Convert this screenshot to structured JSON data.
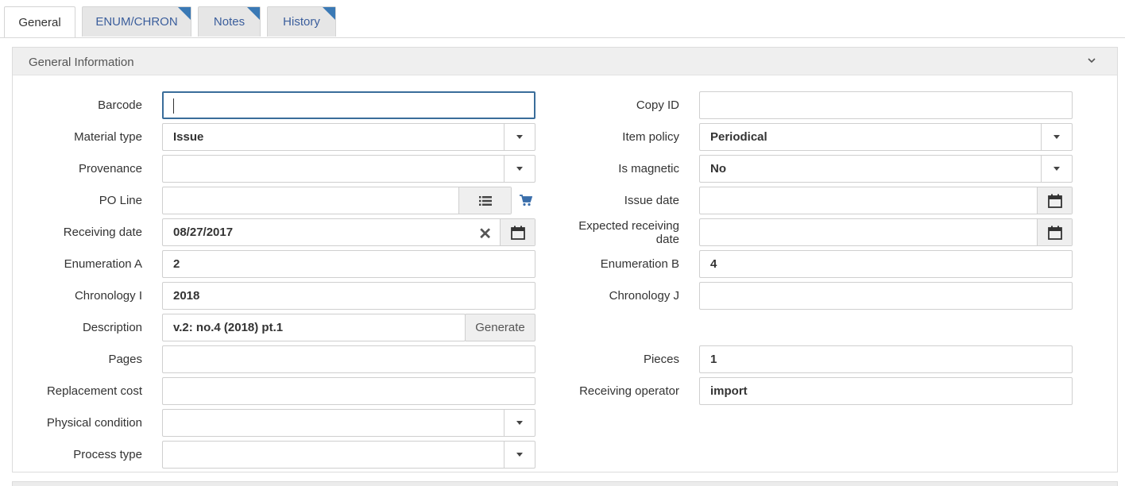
{
  "tabs": [
    {
      "label": "General",
      "active": true
    },
    {
      "label": "ENUM/CHRON"
    },
    {
      "label": "Notes"
    },
    {
      "label": "History"
    }
  ],
  "panel": {
    "title": "General Information",
    "chevron_icon": "chevron-down-icon"
  },
  "left": {
    "barcode": {
      "label": "Barcode",
      "value": ""
    },
    "material_type": {
      "label": "Material type",
      "value": "Issue"
    },
    "provenance": {
      "label": "Provenance",
      "value": ""
    },
    "po_line": {
      "label": "PO Line",
      "value": ""
    },
    "receiving_date": {
      "label": "Receiving date",
      "value": "08/27/2017"
    },
    "enumeration_a": {
      "label": "Enumeration A",
      "value": "2"
    },
    "chronology_i": {
      "label": "Chronology I",
      "value": "2018"
    },
    "description": {
      "label": "Description",
      "value": "v.2: no.4 (2018) pt.1",
      "generate_label": "Generate"
    },
    "pages": {
      "label": "Pages",
      "value": ""
    },
    "replacement_cost": {
      "label": "Replacement cost",
      "value": ""
    },
    "physical_condition": {
      "label": "Physical condition",
      "value": ""
    },
    "process_type": {
      "label": "Process type",
      "value": ""
    }
  },
  "right": {
    "copy_id": {
      "label": "Copy ID",
      "value": ""
    },
    "item_policy": {
      "label": "Item policy",
      "value": "Periodical"
    },
    "is_magnetic": {
      "label": "Is magnetic",
      "value": "No"
    },
    "issue_date": {
      "label": "Issue date",
      "value": ""
    },
    "expected_receiving_date": {
      "label": "Expected receiving date",
      "value": ""
    },
    "enumeration_b": {
      "label": "Enumeration B",
      "value": "4"
    },
    "chronology_j": {
      "label": "Chronology J",
      "value": ""
    },
    "pieces": {
      "label": "Pieces",
      "value": "1"
    },
    "receiving_operator": {
      "label": "Receiving operator",
      "value": "import"
    }
  },
  "colors": {
    "accent": "#3a79b5",
    "link": "#3b5e9c",
    "focus": "#3a6d9a"
  }
}
